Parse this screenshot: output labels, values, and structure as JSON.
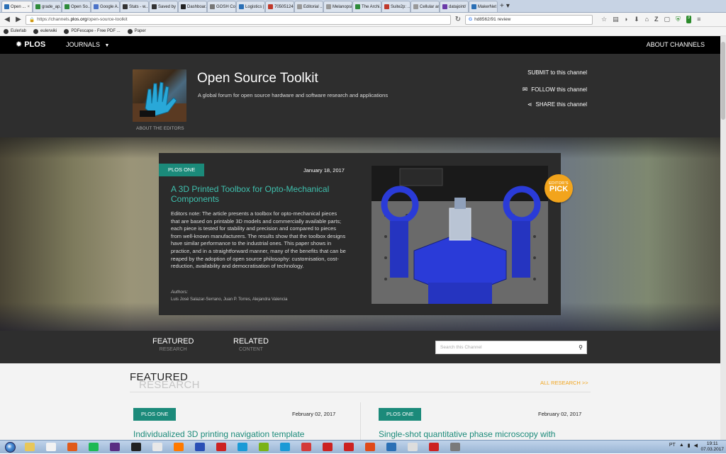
{
  "browser": {
    "tabs": [
      {
        "label": "Open ...",
        "color": "#2a6fb5",
        "active": true
      },
      {
        "label": "grade_ap...",
        "color": "#2e8b3a"
      },
      {
        "label": "Open So...",
        "color": "#2e8b3a"
      },
      {
        "label": "Google A...",
        "color": "#4a72c8"
      },
      {
        "label": "Stats - w...",
        "color": "#333"
      },
      {
        "label": "Saved by ...",
        "color": "#333"
      },
      {
        "label": "Dashboar...",
        "color": "#222"
      },
      {
        "label": "GOSH Co...",
        "color": "#777"
      },
      {
        "label": "Logistics | Gat...",
        "color": "#2a6fb5"
      },
      {
        "label": "70505124 ...",
        "color": "#c0392b"
      },
      {
        "label": "Editorial ...",
        "color": "#999"
      },
      {
        "label": "Melanopsin-E...",
        "color": "#999"
      },
      {
        "label": "The Archi...",
        "color": "#2e8b3a"
      },
      {
        "label": "Suite2p: ...",
        "color": "#c0392b"
      },
      {
        "label": "Cellular and ...",
        "color": "#999"
      },
      {
        "label": "datajoint/",
        "color": "#6a3aa8"
      },
      {
        "label": "MakerNet",
        "color": "#2a6fb5"
      }
    ],
    "tab_controls": [
      "+",
      "▾"
    ],
    "url_prefix": "https://channels.",
    "url_host": "plos.org",
    "url_path": "/open-source-toolkit",
    "search_value": "hd8562/91 review",
    "bookmarks": [
      "Eulerlab",
      "eulerwiki",
      "PDFescape - Free PDF ...",
      "Paper"
    ],
    "notification_count": "3"
  },
  "site": {
    "logo": "PLOS",
    "journals": "JOURNALS",
    "about_channels": "ABOUT CHANNELS",
    "channel_title": "Open Source Toolkit",
    "channel_subtitle": "A global forum for open source hardware and software research and applications",
    "about_editors": "ABOUT THE EDITORS",
    "submit": "SUBMIT to this channel",
    "follow": "FOLLOW this channel",
    "share": "SHARE this channel"
  },
  "feature": {
    "journal": "PLOS ONE",
    "date": "January 18, 2017",
    "title": "A 3D Printed Toolbox for Opto-Mechanical Components",
    "body": "Editors note: The article presents a toolbox for opto-mechanical pieces that are based on printable 3D models and commercially available parts; each piece is tested for stability and precision and compared to pieces from well-known manufacturers. The results show that the toolbox designs have similar performance to the industrial ones. This paper shows in practice, and in a straightforward manner, many of the benefits that can be reaped by the adoption of open source philosophy: customisation, cost-reduction, availability and democratisation of technology.",
    "authors_label": "Authors:",
    "authors": "Luis José Salazar-Serrano, Juan P. Torres, Alejandra Valencia",
    "pick_small": "EDITOR'S",
    "pick_big": "PICK"
  },
  "content_tabs": {
    "featured": "FEATURED",
    "featured_sub": "RESEARCH",
    "related": "RELATED",
    "related_sub": "CONTENT",
    "search_placeholder": "Search this Channel"
  },
  "featured_section": {
    "heading": "FEATURED",
    "heading_shadow": "RESEARCH",
    "all_research": "ALL RESEARCH >>",
    "items": [
      {
        "journal": "PLOS ONE",
        "date": "February 02, 2017",
        "title": "Individualized 3D printing navigation template"
      },
      {
        "journal": "PLOS ONE",
        "date": "February 02, 2017",
        "title": "Single-shot quantitative phase microscopy with"
      }
    ]
  },
  "taskbar": {
    "apps": [
      "#e8c75a",
      "#f2f2f2",
      "#e05a1a",
      "#1db954",
      "#5a2d82",
      "#222",
      "#e8e8e8",
      "#ff7a00",
      "#2a4fb5",
      "#cc2222",
      "#1a9ad6",
      "#7ab317",
      "#1a9ad6",
      "#d43a3a",
      "#cc2222",
      "#cc2222",
      "#e04a1a",
      "#2a6fb5",
      "#ddd",
      "#cc2222",
      "#7a7a7a"
    ],
    "lang": "PT",
    "time": "19:11",
    "date": "07.03.2017"
  }
}
